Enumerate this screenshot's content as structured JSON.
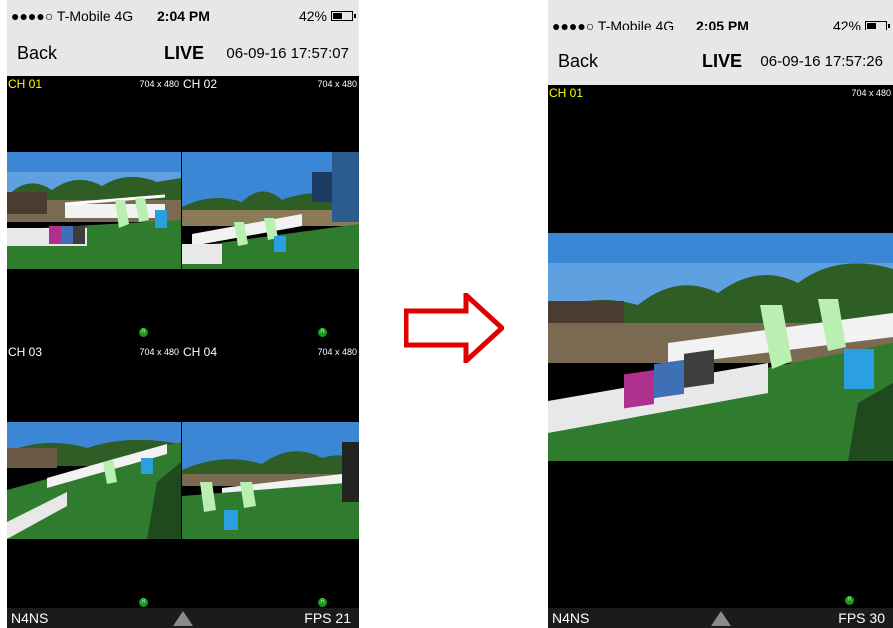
{
  "left": {
    "status": {
      "carrier": "●●●●○ T-Mobile  4G",
      "time": "2:04 PM",
      "battery": "42%"
    },
    "nav": {
      "back": "Back",
      "title": "LIVE",
      "datetime": "06-09-16 17:57:07"
    },
    "channels": [
      {
        "label": "CH 01",
        "resolution": "704 x 480",
        "rec": "R"
      },
      {
        "label": "CH 02",
        "resolution": "704 x 480",
        "rec": "R"
      },
      {
        "label": "CH 03",
        "resolution": "704 x 480",
        "rec": "R"
      },
      {
        "label": "CH 04",
        "resolution": "704 x 480",
        "rec": "R"
      }
    ],
    "bottom": {
      "model": "N4NS",
      "fps": "FPS 21"
    }
  },
  "right": {
    "status": {
      "carrier": "●●●●○ T-Mobile  4G",
      "time": "2:05 PM",
      "battery": "42%"
    },
    "nav": {
      "back": "Back",
      "title": "LIVE",
      "datetime": "06-09-16 17:57:26"
    },
    "channel": {
      "label": "CH 01",
      "resolution": "704 x 480",
      "rec": "R"
    },
    "bottom": {
      "model": "N4NS",
      "fps": "FPS 30"
    }
  },
  "colors": {
    "selected_channel": "#ffff00",
    "transition_arrow": "#e00000",
    "rec_indicator": "#1a9a1a"
  },
  "icons": {
    "transition": "right-arrow-icon",
    "expand": "up-triangle-icon",
    "recording": "rec-icon"
  }
}
